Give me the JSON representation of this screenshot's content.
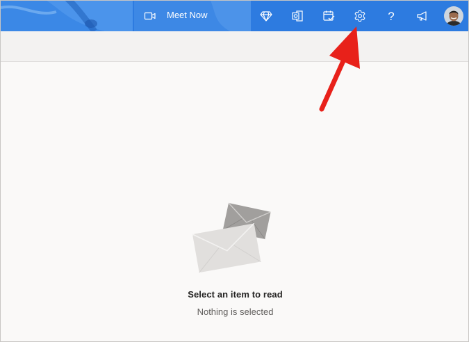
{
  "topbar": {
    "meet_now_label": "Meet Now",
    "icons": [
      "video-icon",
      "diamond-icon",
      "office-icon",
      "calendar-check-icon",
      "gear-icon",
      "help-icon",
      "megaphone-icon"
    ],
    "help_glyph": "?",
    "accent_color": "#2f7fe0"
  },
  "reading_pane": {
    "title": "Select an item to read",
    "subtitle": "Nothing is selected"
  },
  "annotation": {
    "arrow_color": "#e8211a",
    "points_to": "gear-icon"
  }
}
